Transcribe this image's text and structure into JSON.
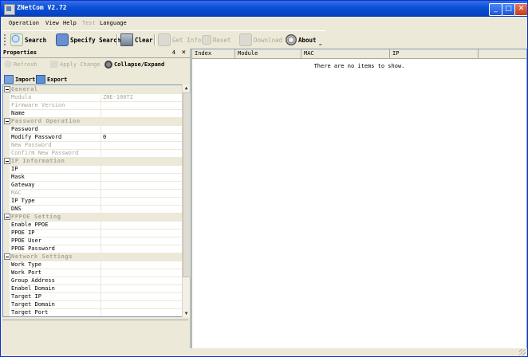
{
  "window": {
    "title": "ZNetCom V2.72"
  },
  "titlebar_buttons": {
    "minimize": "_",
    "maximize": "□",
    "close": "✕"
  },
  "menu": [
    "Operation",
    "View",
    "Help",
    "Test",
    "Language"
  ],
  "toolbar": {
    "search": "Search",
    "specify_search": "Specify Search",
    "clear": "Clear",
    "get_info": "Get Info",
    "reset": "Reset",
    "download": "Download",
    "about": "About",
    "overflow": "="
  },
  "properties": {
    "title": "Properties",
    "pin": "4",
    "close": "×",
    "refresh": "Refresh",
    "apply_change": "Apply Change",
    "collapse_expand": "Collapse/Expand",
    "import": "Import",
    "export": "Export",
    "rows": [
      {
        "type": "cat",
        "name": "General"
      },
      {
        "type": "prop",
        "name": "Modula",
        "value": "ZNE-100TI",
        "disabled": true
      },
      {
        "type": "prop",
        "name": "Firmware Version",
        "value": "",
        "disabled": true
      },
      {
        "type": "prop",
        "name": "Name",
        "value": ""
      },
      {
        "type": "cat",
        "name": "Password Operation"
      },
      {
        "type": "prop",
        "name": "Password",
        "value": ""
      },
      {
        "type": "prop",
        "name": "Modify Password",
        "value": "0"
      },
      {
        "type": "prop",
        "name": "New Password",
        "value": "",
        "disabled": true
      },
      {
        "type": "prop",
        "name": "Confirm New Password",
        "value": "",
        "disabled": true
      },
      {
        "type": "cat",
        "name": "IP Information"
      },
      {
        "type": "prop",
        "name": "IP",
        "value": ""
      },
      {
        "type": "prop",
        "name": "Mask",
        "value": ""
      },
      {
        "type": "prop",
        "name": "Gateway",
        "value": ""
      },
      {
        "type": "prop",
        "name": "MAC",
        "value": "",
        "disabled": true
      },
      {
        "type": "prop",
        "name": "IP Type",
        "value": ""
      },
      {
        "type": "prop",
        "name": "DNS",
        "value": ""
      },
      {
        "type": "cat",
        "name": "PPPOE Setting"
      },
      {
        "type": "prop",
        "name": "Enable PPOE",
        "value": ""
      },
      {
        "type": "prop",
        "name": "PPOE IP",
        "value": ""
      },
      {
        "type": "prop",
        "name": "PPOE User",
        "value": ""
      },
      {
        "type": "prop",
        "name": "PPOE Password",
        "value": ""
      },
      {
        "type": "cat",
        "name": "Network Settings"
      },
      {
        "type": "prop",
        "name": "Work Type",
        "value": ""
      },
      {
        "type": "prop",
        "name": "Work Port",
        "value": ""
      },
      {
        "type": "prop",
        "name": "Group Address",
        "value": ""
      },
      {
        "type": "prop",
        "name": "Enabel Domain",
        "value": ""
      },
      {
        "type": "prop",
        "name": "Target IP",
        "value": ""
      },
      {
        "type": "prop",
        "name": "Target Domain",
        "value": ""
      },
      {
        "type": "prop",
        "name": "Target Port",
        "value": ""
      }
    ]
  },
  "device_list": {
    "columns": [
      "Index",
      "Module",
      "MAC",
      "IP"
    ],
    "empty_message": "There are no items to show."
  }
}
